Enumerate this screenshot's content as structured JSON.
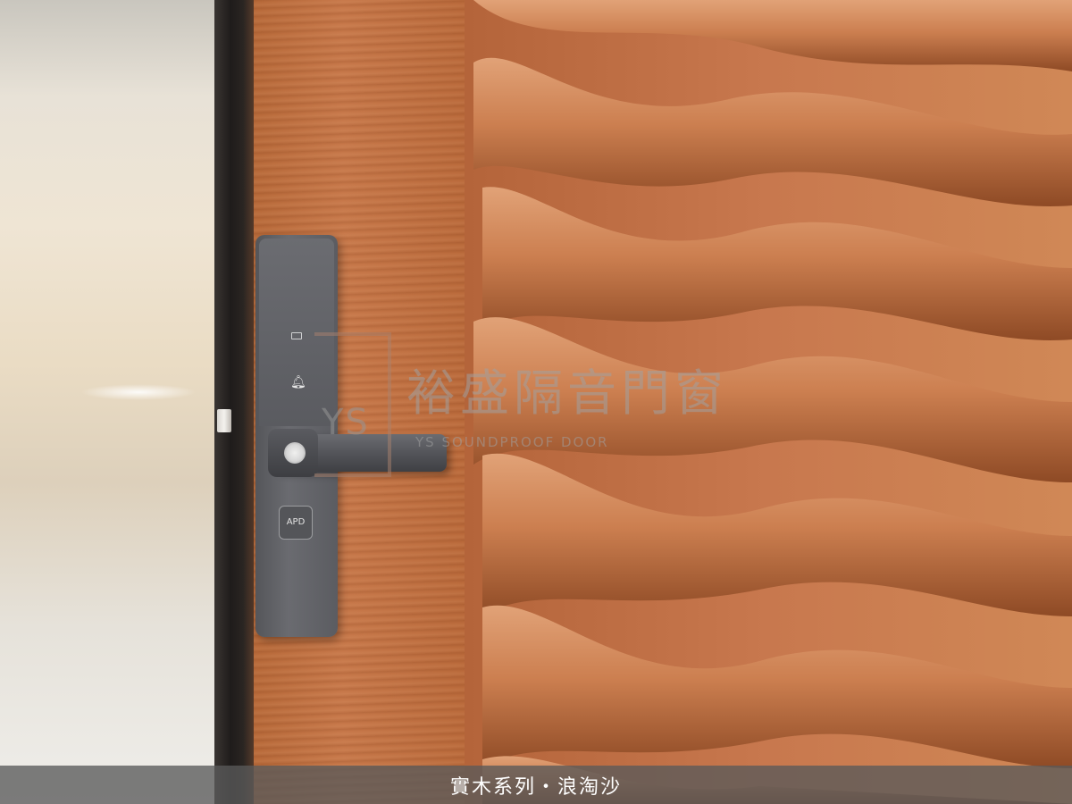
{
  "watermark": {
    "logo_letters": "YS",
    "brand_name": "裕盛隔音門窗",
    "brand_subtitle": "YS SOUNDPROOF DOOR"
  },
  "lock": {
    "button_label": "APD"
  },
  "caption": {
    "text": "實木系列・浪淘沙"
  },
  "colors": {
    "wood": "#c8784e",
    "lock_metal": "#5b5c61",
    "caption_bg": "#5a5a5a"
  }
}
